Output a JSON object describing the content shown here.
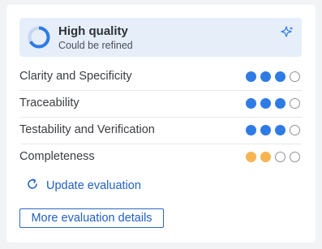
{
  "quality": {
    "title": "High quality",
    "subtitle": "Could be refined",
    "ring_level": 0.67,
    "accent": "#2f7be5"
  },
  "criteria": [
    {
      "label": "Clarity and Specificity",
      "rating": 3,
      "max": 4,
      "color": "#2f7be5"
    },
    {
      "label": "Traceability",
      "rating": 3,
      "max": 4,
      "color": "#2f7be5"
    },
    {
      "label": "Testability and Verification",
      "rating": 3,
      "max": 4,
      "color": "#2f7be5"
    },
    {
      "label": "Completeness",
      "rating": 2,
      "max": 4,
      "color": "#f5b451"
    }
  ],
  "actions": {
    "update_label": "Update evaluation",
    "details_label": "More evaluation details"
  },
  "icons": {
    "ring": "progress-ring-icon",
    "sparkle": "sparkle-icon",
    "refresh": "refresh-icon"
  }
}
